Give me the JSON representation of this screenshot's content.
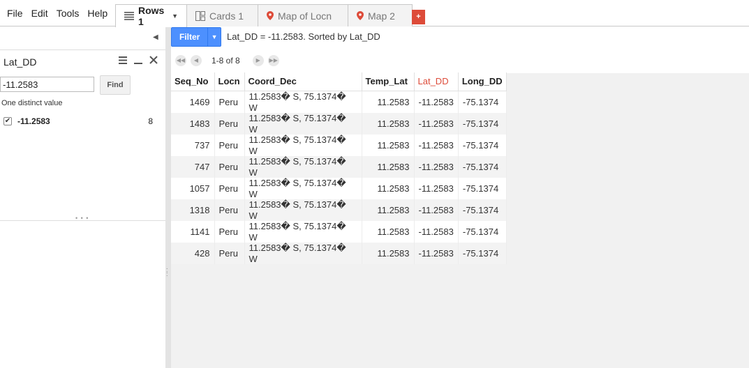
{
  "menu": [
    "File",
    "Edit",
    "Tools",
    "Help"
  ],
  "tabs": [
    {
      "label": "Rows 1",
      "icon": "rows-icon",
      "active": true
    },
    {
      "label": "Cards 1",
      "icon": "cards-icon",
      "active": false
    },
    {
      "label": "Map of Locn",
      "icon": "map-pin-icon",
      "active": false
    },
    {
      "label": "Map 2",
      "icon": "map-pin-icon",
      "active": false
    }
  ],
  "add_tab_label": "+",
  "filter_panel": {
    "title": "Lat_DD",
    "search_value": "-11.2583",
    "find_label": "Find",
    "distinct_text": "One distinct value",
    "values": [
      {
        "label": "-11.2583",
        "count": "8",
        "checked": true
      }
    ]
  },
  "filter_button_label": "Filter",
  "filter_status": "Lat_DD = -11.2583. Sorted by Lat_DD",
  "pager_info": "1-8 of 8",
  "table": {
    "columns": [
      "Seq_No",
      "Locn",
      "Coord_Dec",
      "Temp_Lat",
      "Lat_DD",
      "Long_DD"
    ],
    "sorted_column": "Lat_DD",
    "rows": [
      [
        "1469",
        "Peru",
        "11.2583� S, 75.1374� W",
        "11.2583",
        "-11.2583",
        "-75.1374"
      ],
      [
        "1483",
        "Peru",
        "11.2583� S, 75.1374� W",
        "11.2583",
        "-11.2583",
        "-75.1374"
      ],
      [
        "737",
        "Peru",
        "11.2583� S, 75.1374� W",
        "11.2583",
        "-11.2583",
        "-75.1374"
      ],
      [
        "747",
        "Peru",
        "11.2583� S, 75.1374� W",
        "11.2583",
        "-11.2583",
        "-75.1374"
      ],
      [
        "1057",
        "Peru",
        "11.2583� S, 75.1374� W",
        "11.2583",
        "-11.2583",
        "-75.1374"
      ],
      [
        "1318",
        "Peru",
        "11.2583� S, 75.1374� W",
        "11.2583",
        "-11.2583",
        "-75.1374"
      ],
      [
        "1141",
        "Peru",
        "11.2583� S, 75.1374� W",
        "11.2583",
        "-11.2583",
        "-75.1374"
      ],
      [
        "428",
        "Peru",
        "11.2583� S, 75.1374� W",
        "11.2583",
        "-11.2583",
        "-75.1374"
      ]
    ]
  },
  "colors": {
    "accent": "#4d90fe",
    "sorted_header": "#dd4b39",
    "add_tab": "#dd4b39"
  }
}
